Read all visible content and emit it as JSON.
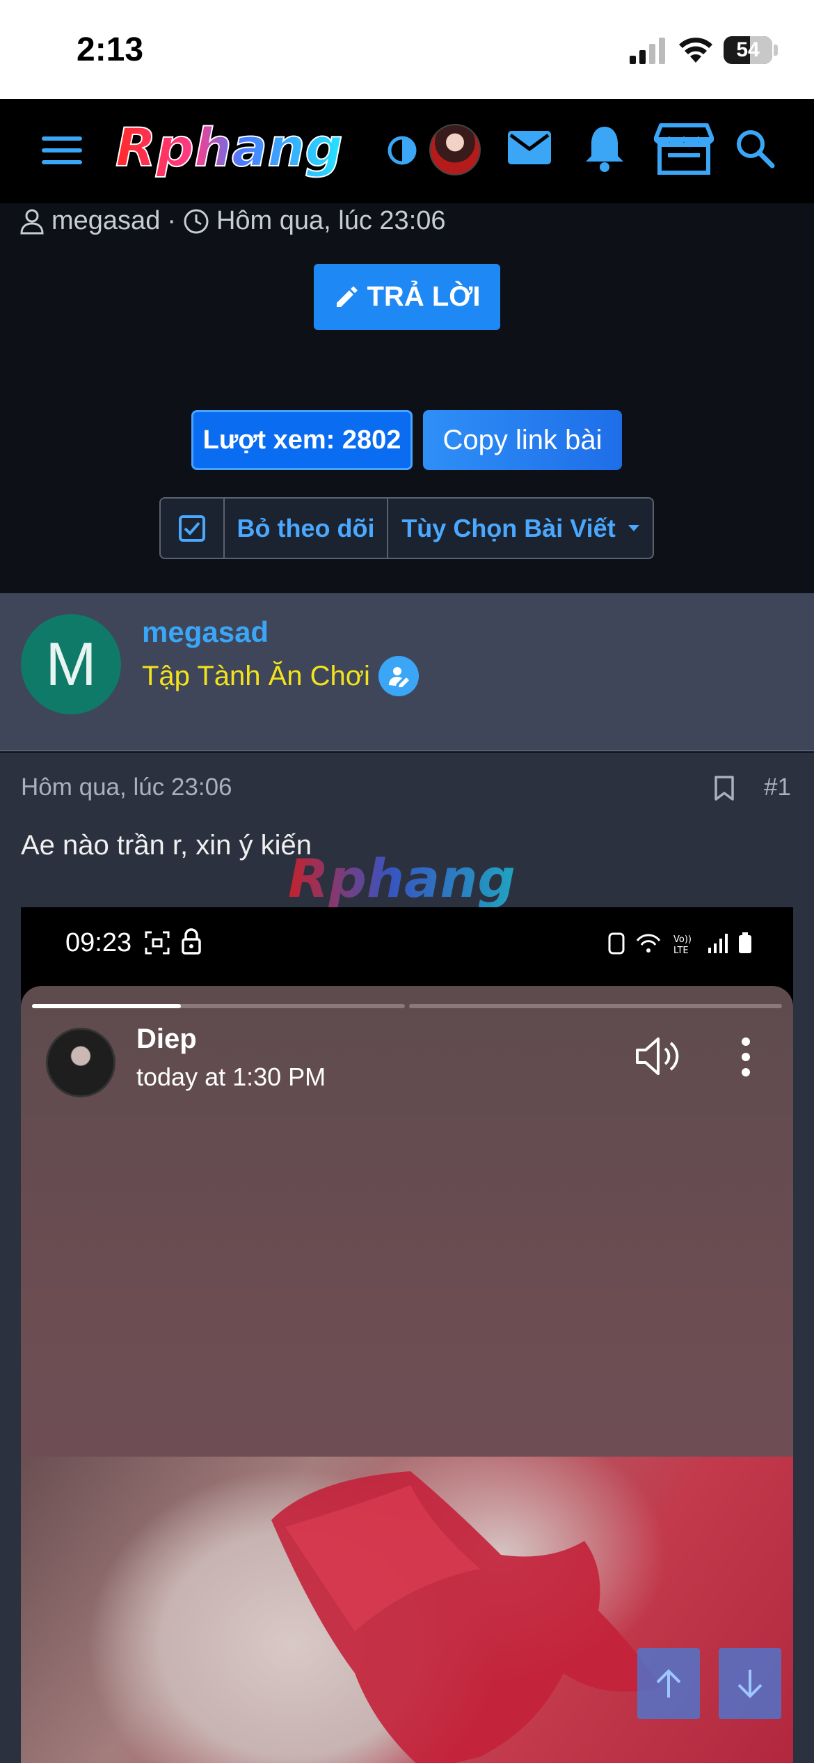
{
  "status_bar": {
    "time": "2:13",
    "battery": "54",
    "battery_level": 0.54
  },
  "nav": {
    "logo_text": "Rphang",
    "icons": [
      "menu-icon",
      "contrast-icon",
      "avatar",
      "mail-icon",
      "bell-icon",
      "store-icon",
      "search-icon"
    ]
  },
  "thread_meta": {
    "author": "megasad",
    "separator": "·",
    "time": "Hôm qua, lúc 23:06"
  },
  "actions": {
    "reply_label": "TRẢ LỜI",
    "views_label": "Lượt xem: 2802",
    "copy_label": "Copy link bài",
    "unfollow_label": "Bỏ theo dõi",
    "options_label": "Tùy Chọn Bài Viết"
  },
  "user": {
    "avatar_letter": "M",
    "name": "megasad",
    "title": "Tập Tành Ăn Chơi"
  },
  "post": {
    "date": "Hôm qua, lúc 23:06",
    "number": "#1",
    "text": "Ae nào trần r, xin ý kiến",
    "watermark": "Rphang"
  },
  "embed": {
    "phone_time": "09:23",
    "story_name": "Diep",
    "story_time": "today at 1:30 PM",
    "story_progress": 0.4
  },
  "colors": {
    "accent_blue": "#1e88f5",
    "link_blue": "#3aa6f5",
    "title_yellow": "#f3e31d",
    "avatar_teal": "#0f7a67"
  }
}
